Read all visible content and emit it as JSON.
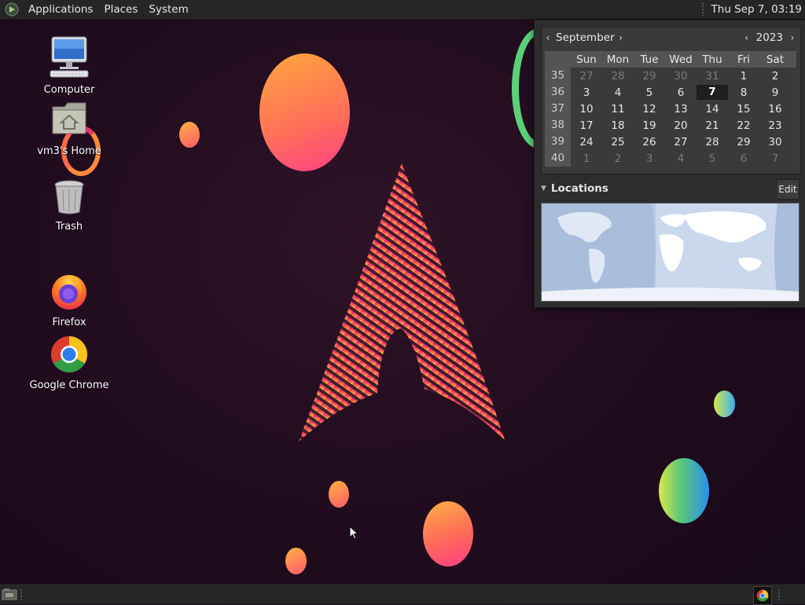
{
  "top_panel": {
    "menus": [
      "Applications",
      "Places",
      "System"
    ],
    "clock": "Thu Sep  7, 03:19"
  },
  "desktop_icons": [
    {
      "label": "Computer",
      "icon": "computer-icon"
    },
    {
      "label": "vm3's Home",
      "icon": "home-folder-icon"
    },
    {
      "label": "Trash",
      "icon": "trash-icon"
    },
    {
      "label": "Firefox",
      "icon": "firefox-icon"
    },
    {
      "label": "Google Chrome",
      "icon": "chrome-icon"
    }
  ],
  "calendar": {
    "month": "September",
    "year": "2023",
    "weekdays": [
      "Sun",
      "Mon",
      "Tue",
      "Wed",
      "Thu",
      "Fri",
      "Sat"
    ],
    "weeks": [
      {
        "num": "35",
        "days": [
          "27",
          "28",
          "29",
          "30",
          "31",
          "1",
          "2"
        ]
      },
      {
        "num": "36",
        "days": [
          "3",
          "4",
          "5",
          "6",
          "7",
          "8",
          "9"
        ]
      },
      {
        "num": "37",
        "days": [
          "10",
          "11",
          "12",
          "13",
          "14",
          "15",
          "16"
        ]
      },
      {
        "num": "38",
        "days": [
          "17",
          "18",
          "19",
          "20",
          "21",
          "22",
          "23"
        ]
      },
      {
        "num": "39",
        "days": [
          "24",
          "25",
          "26",
          "27",
          "28",
          "29",
          "30"
        ]
      },
      {
        "num": "40",
        "days": [
          "1",
          "2",
          "3",
          "4",
          "5",
          "6",
          "7"
        ]
      }
    ],
    "selected_day": "7",
    "locations_label": "Locations",
    "edit_label": "Edit"
  },
  "colors": {
    "panel": "#262626",
    "desktop_bg": "#220d1f",
    "accent_pink": "#e8336f",
    "accent_orange": "#ff9a3c"
  }
}
